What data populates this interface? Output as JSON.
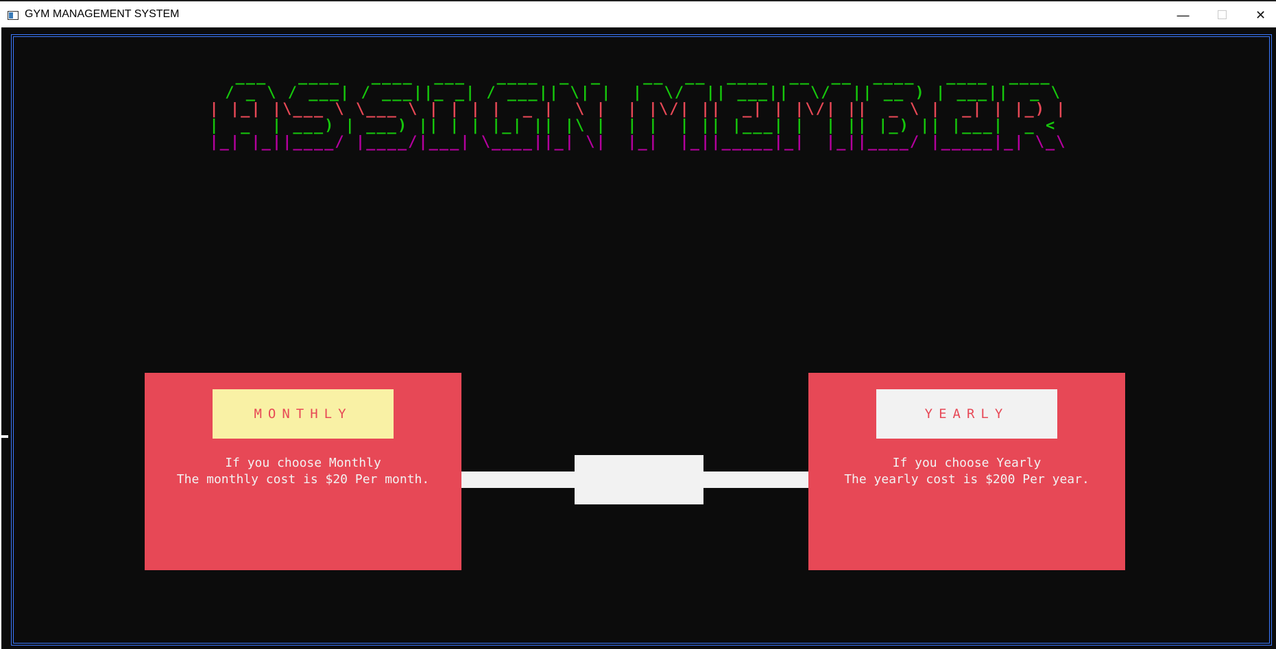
{
  "window": {
    "title": "GYM MANAGEMENT SYSTEM",
    "minimize_symbol": "—",
    "maximize_symbol": "☐",
    "close_symbol": "✕"
  },
  "colors": {
    "console_bg": "#0c0c0c",
    "frame": "#3b78ff",
    "card": "#e74856",
    "monthly_button": "#f9f1a5",
    "yearly_button": "#f2f2f2",
    "text_light": "#f2f2f2"
  },
  "banner": {
    "text": "ASSIGN MEMBER",
    "lines": [
      "  ___   ____   ____  ___   ____  _  _    __  __  ____  __  __  ____   ____  ____ ",
      " / _ \\ / ___| / ___||_ _| / ___|| \\| |  |  \\/  || ___||  \\/  || __ ) | ___||  _ \\",
      "| |_| |\\___ \\ \\___ \\ | | | |  _ |  \\ |  | |\\/| ||  _| | |\\/| ||  _ \\ |  _| | |_) |",
      "|  _  | ___) | ___) || | | |_| || |\\ |  | |  | || |___| |  | || |_) || |___|  _ < ",
      "|_| |_||____/ |____/|___| \\____||_| \\|  |_|  |_||_____|_|  |_||____/ |_____|_| \\_\\",
      "                                                                                  ",
      "                                                                                  "
    ]
  },
  "plans": {
    "monthly": {
      "button_label": "MONTHLY",
      "line1": "If you choose Monthly",
      "line2": "The monthly cost is $20 Per month."
    },
    "yearly": {
      "button_label": "YEARLY",
      "line1": "If you choose Yearly",
      "line2": "The yearly cost is $200 Per year."
    }
  }
}
